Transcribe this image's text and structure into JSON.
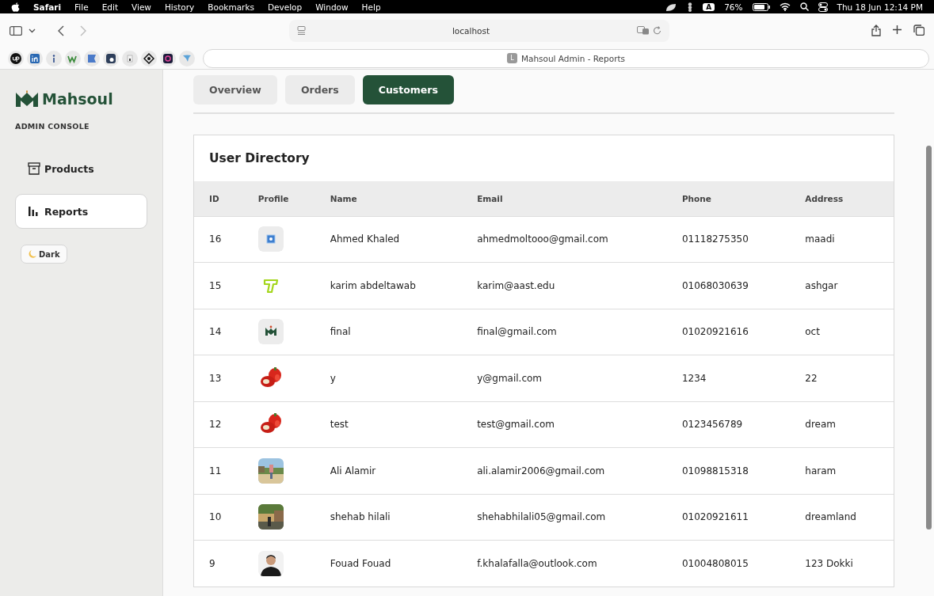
{
  "menubar": {
    "app": "Safari",
    "menus": [
      "File",
      "Edit",
      "View",
      "History",
      "Bookmarks",
      "Develop",
      "Window",
      "Help"
    ],
    "input_source": "A",
    "battery": "76%",
    "clock": "Thu 18 Jun  12:14 PM"
  },
  "browser": {
    "address": "localhost",
    "tab_letter": "L",
    "tab_title": "Mahsoul Admin - Reports"
  },
  "sidebar": {
    "brand": "Mahsoul",
    "subtitle": "ADMIN CONSOLE",
    "items": [
      {
        "label": "Products",
        "kind": "box",
        "selected": false
      },
      {
        "label": "Reports",
        "kind": "chart",
        "selected": true
      }
    ],
    "theme_button": "Dark"
  },
  "tabs": [
    {
      "label": "Overview",
      "selected": false
    },
    {
      "label": "Orders",
      "selected": false
    },
    {
      "label": "Customers",
      "selected": true
    }
  ],
  "table": {
    "title": "User Directory",
    "columns": [
      "ID",
      "Profile",
      "Name",
      "Email",
      "Phone",
      "Address"
    ],
    "rows": [
      {
        "id": "16",
        "avatar": {
          "kind": "placeholder"
        },
        "name": "Ahmed Khaled",
        "email": "ahmedmoltooo@gmail.com",
        "phone": "01118275350",
        "address": "maadi"
      },
      {
        "id": "15",
        "avatar": {
          "kind": "letter-logo"
        },
        "name": "karim abdeltawab",
        "email": "karim@aast.edu",
        "phone": "01068030639",
        "address": "ashgar"
      },
      {
        "id": "14",
        "avatar": {
          "kind": "brand-logo"
        },
        "name": "final",
        "email": "final@gmail.com",
        "phone": "01020921616",
        "address": "oct"
      },
      {
        "id": "13",
        "avatar": {
          "kind": "peppers"
        },
        "name": "y",
        "email": "y@gmail.com",
        "phone": "1234",
        "address": "22"
      },
      {
        "id": "12",
        "avatar": {
          "kind": "peppers"
        },
        "name": "test",
        "email": "test@gmail.com",
        "phone": "0123456789",
        "address": "dream"
      },
      {
        "id": "11",
        "avatar": {
          "kind": "outdoor"
        },
        "name": "Ali Alamir",
        "email": "ali.alamir2006@gmail.com",
        "phone": "01098815318",
        "address": "haram"
      },
      {
        "id": "10",
        "avatar": {
          "kind": "street"
        },
        "name": "shehab hilali",
        "email": "shehabhilali05@gmail.com",
        "phone": "01020921611",
        "address": "dreamland"
      },
      {
        "id": "9",
        "avatar": {
          "kind": "person"
        },
        "name": "Fouad Fouad",
        "email": "f.khalafalla@outlook.com",
        "phone": "01004808015",
        "address": "123 Dokki"
      }
    ]
  }
}
